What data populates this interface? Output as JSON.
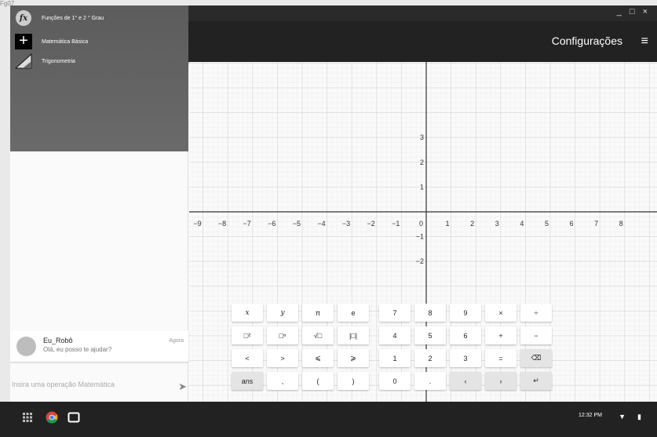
{
  "top_label": "Fg07",
  "window": {
    "controls": [
      "_",
      "□",
      "×"
    ]
  },
  "appbar": {
    "title": "Configurações",
    "menu_icon": "menu-icon"
  },
  "drawer": {
    "items": [
      {
        "label": "Funções de 1° e 2 ° Grau",
        "icon": "function-fx-icon",
        "icon_text": "fx"
      },
      {
        "label": "Matemática Básica",
        "icon": "plus-icon",
        "icon_text": "+"
      },
      {
        "label": "Trigonometria",
        "icon": "triangle-ruler-icon",
        "icon_text": ""
      }
    ]
  },
  "chat": {
    "name": "Eu_Robô",
    "message": "Olá, eu posso te ajudar?",
    "time": "Agora"
  },
  "input": {
    "placeholder": "Insira uma operação Matemática",
    "send_icon": "send-icon"
  },
  "graph": {
    "x_ticks": [
      "−9",
      "−8",
      "−7",
      "−6",
      "−5",
      "−4",
      "−3",
      "−2",
      "−1",
      "0",
      "1",
      "2",
      "3",
      "4",
      "5",
      "6",
      "7",
      "8"
    ],
    "y_ticks_pos": [
      "3",
      "2",
      "1"
    ],
    "y_ticks_neg": [
      "−1",
      "−2"
    ],
    "grid": true,
    "grid_color": "#dcdcdc",
    "axis_color": "#333333"
  },
  "keyboard": {
    "left": [
      [
        "x",
        "y",
        "π",
        "e"
      ],
      [
        "□²",
        "□ⁿ",
        "√□",
        "|□|"
      ],
      [
        "<",
        ">",
        "⩽",
        "⩾"
      ],
      [
        "ans",
        ",",
        "(",
        ")"
      ]
    ],
    "right": [
      [
        "7",
        "8",
        "9",
        "×",
        "÷"
      ],
      [
        "4",
        "5",
        "6",
        "+",
        "−"
      ],
      [
        "1",
        "2",
        "3",
        "=",
        "⌫"
      ],
      [
        "0",
        ".",
        "‹",
        "›",
        "↵"
      ]
    ]
  },
  "taskbar": {
    "time": "12:32 PM",
    "wifi_icon": "wifi-icon",
    "battery_icon": "battery-icon"
  }
}
